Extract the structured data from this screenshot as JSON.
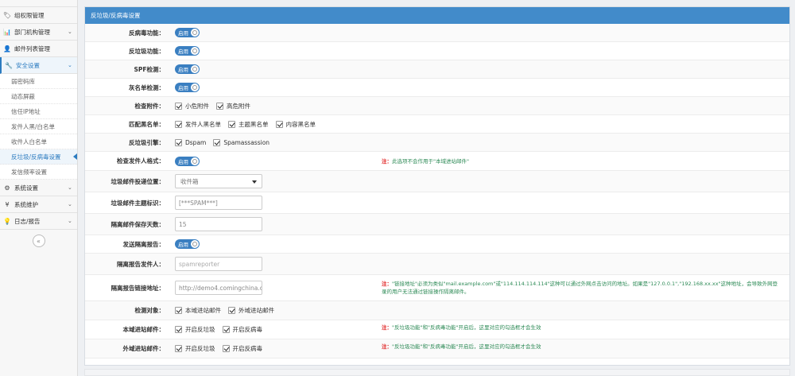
{
  "sidebar": {
    "items_top": [
      {
        "icon": "tag-icon",
        "glyph": "🏷",
        "label": "组权限管理",
        "chev": ""
      },
      {
        "icon": "bar-chart-icon",
        "glyph": "📊",
        "label": "部门机构管理",
        "chev": "⌄"
      },
      {
        "icon": "user-icon",
        "glyph": "👤",
        "label": "邮件列表管理",
        "chev": ""
      },
      {
        "icon": "wrench-icon",
        "glyph": "🔧",
        "label": "安全设置",
        "chev": "⌄"
      }
    ],
    "sub_items": [
      "弱密码库",
      "动态屏蔽",
      "信任IP地址",
      "发件人黑/白名单",
      "收件人白名单",
      "反垃圾/反病毒设置",
      "发信频率设置"
    ],
    "items_bottom": [
      {
        "icon": "gear-icon",
        "glyph": "⚙",
        "label": "系统设置",
        "chev": "⌄"
      },
      {
        "icon": "yen-icon",
        "glyph": "¥",
        "label": "系统维护",
        "chev": "⌄"
      },
      {
        "icon": "bulb-icon",
        "glyph": "💡",
        "label": "日志/报告",
        "chev": "⌄"
      }
    ],
    "collapse_glyph": "«"
  },
  "panel": {
    "title": "反垃圾/反病毒设置"
  },
  "toggle_text": "启用",
  "rows": {
    "antivirus": {
      "label": "反病毒功能："
    },
    "antispam": {
      "label": "反垃圾功能："
    },
    "spf": {
      "label": "SPF检测："
    },
    "blacklist": {
      "label": "灰名单检测："
    },
    "attach": {
      "label": "检查附件：",
      "options": [
        "小危附件",
        "高危附件"
      ]
    },
    "blacklist_match": {
      "label": "匹配黑名单：",
      "options": [
        "发件人黑名单",
        "主题黑名单",
        "内容黑名单"
      ]
    },
    "engine": {
      "label": "反垃圾引擎：",
      "options": [
        "Dspam",
        "Spamassassion"
      ]
    },
    "sender_format": {
      "label": "检查发件人格式：",
      "note_prefix": "注：",
      "note": "此选项不会作用于\"本域进站邮件\""
    },
    "spam_folder": {
      "label": "垃圾邮件投递位置：",
      "value": "收件箱"
    },
    "spam_tag": {
      "label": "垃圾邮件主题标识：",
      "value": "[***SPAM***]"
    },
    "quarantine_days": {
      "label": "隔离邮件保存天数：",
      "value": "15"
    },
    "send_report": {
      "label": "发送隔离报告："
    },
    "report_sender": {
      "label": "隔离报告发件人：",
      "placeholder": "spamreporter"
    },
    "report_link": {
      "label": "隔离报告链接地址：",
      "value": "http://demo4.comingchina.c",
      "note_prefix": "注：",
      "note": "\"链接地址\"必须为类似\"mail.example.com\"或\"114.114.114.114\"这种可以通过外网点击访问的地址。如果是\"127.0.0.1\",\"192.168.xx.xx\"这种地址，会导致外网登录的用户无法通过链接操作隔离邮件。"
    },
    "check_target": {
      "label": "检测对象：",
      "options": [
        "本域进站邮件",
        "外域进站邮件"
      ]
    },
    "local_inbound": {
      "label": "本域进站邮件：",
      "options": [
        "开启反垃圾",
        "开启反病毒"
      ],
      "note_prefix": "注：",
      "note": "\"反垃圾功能\"和\"反病毒功能\"开启后，这里对应的勾选框才会生效"
    },
    "remote_inbound": {
      "label": "外域进站邮件：",
      "options": [
        "开启反垃圾",
        "开启反病毒"
      ],
      "note_prefix": "注：",
      "note": "\"反垃圾功能\"和\"反病毒功能\"开启后，这里对应的勾选框才会生效"
    }
  },
  "colors": {
    "header": "#428bca",
    "toggle": "#3a7fc1",
    "note": "#2e8b57",
    "note_prefix": "#e02020"
  }
}
